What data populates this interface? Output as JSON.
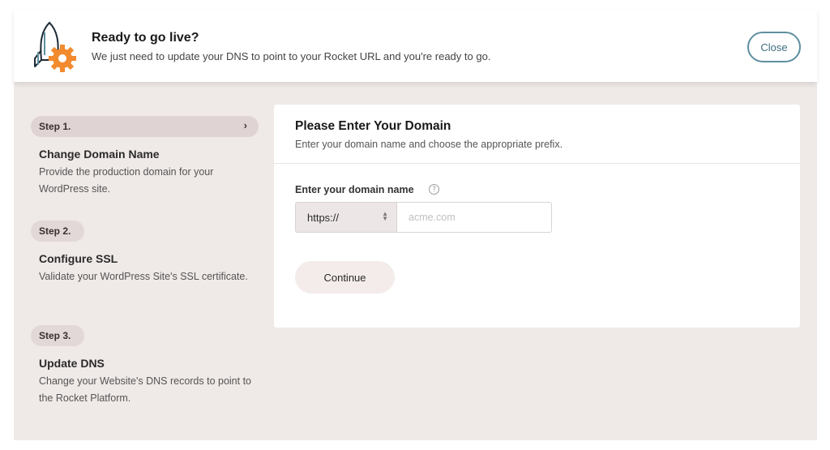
{
  "header": {
    "title": "Ready to go live?",
    "subtitle": "We just need to update your DNS to point to your Rocket URL and you're ready to go.",
    "close_label": "Close",
    "logo_icon": "rocket-gear-icon"
  },
  "steps": [
    {
      "pill": "Step 1.",
      "title": "Change Domain Name",
      "description": "Provide the production domain for your WordPress site.",
      "active": true
    },
    {
      "pill": "Step 2.",
      "title": "Configure SSL",
      "description": "Validate your WordPress Site's SSL certificate.",
      "active": false
    },
    {
      "pill": "Step 3.",
      "title": "Update DNS",
      "description": "Change your Website's DNS records to point to the Rocket Platform.",
      "active": false
    }
  ],
  "card": {
    "title": "Please Enter Your Domain",
    "subtitle": "Enter your domain name and choose the appropriate prefix.",
    "field_label": "Enter your domain name",
    "help_icon": "question-icon",
    "prefix_value": "https://",
    "domain_placeholder": "acme.com",
    "continue_label": "Continue"
  },
  "colors": {
    "accent_orange": "#f28a2e",
    "close_border": "#5e8f9f",
    "page_bg": "#efe9e7"
  }
}
